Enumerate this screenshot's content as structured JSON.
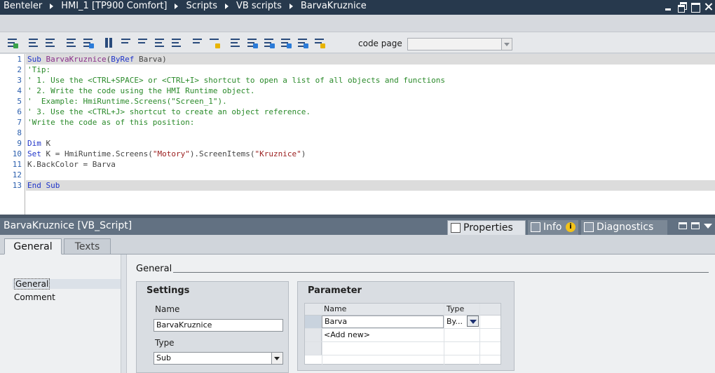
{
  "titlebar": {
    "breadcrumbs": [
      "Benteler",
      "HMI_1 [TP900 Comfort]",
      "Scripts",
      "VB scripts",
      "BarvaKruznice"
    ]
  },
  "toolbar": {
    "icons": [
      "compile-icon",
      "indent-icon",
      "outdent-icon",
      "comment-icon",
      "uncomment-icon",
      "bookmark-icon",
      "prev-bookmark-icon",
      "next-bookmark-icon",
      "delete-bookmarks-icon",
      "goto-icon",
      "find-icon",
      "highlight-icon",
      "select-object-icon",
      "object-list-icon",
      "member-list-icon",
      "parameter-info-icon",
      "word-complete-icon",
      "snippet-icon"
    ],
    "code_page_label": "code page",
    "code_page_value": ""
  },
  "editor": {
    "line_numbers": [
      "1",
      "2",
      "3",
      "4",
      "5",
      "6",
      "7",
      "8",
      "9",
      "10",
      "11",
      "12",
      "13"
    ],
    "lines": [
      {
        "n": 1,
        "parts": [
          [
            "kw",
            "Sub "
          ],
          [
            "fn",
            "BarvaKruznice"
          ],
          [
            "ob",
            "("
          ],
          [
            "kw",
            "ByRef"
          ],
          [
            "ob",
            " Barva)"
          ]
        ]
      },
      {
        "n": 2,
        "parts": [
          [
            "cm",
            "'Tip:"
          ]
        ]
      },
      {
        "n": 3,
        "parts": [
          [
            "cm",
            "' 1. Use the <CTRL+SPACE> or <CTRL+I> shortcut to open a list of all objects and functions"
          ]
        ]
      },
      {
        "n": 4,
        "parts": [
          [
            "cm",
            "' 2. Write the code using the HMI Runtime object."
          ]
        ]
      },
      {
        "n": 5,
        "parts": [
          [
            "cm",
            "'  Example: HmiRuntime.Screens(\"Screen_1\")."
          ]
        ]
      },
      {
        "n": 6,
        "parts": [
          [
            "cm",
            "' 3. Use the <CTRL+J> shortcut to create an object reference."
          ]
        ]
      },
      {
        "n": 7,
        "parts": [
          [
            "cm",
            "'Write the code as of this position:"
          ]
        ]
      },
      {
        "n": 8,
        "parts": []
      },
      {
        "n": 9,
        "parts": [
          [
            "kw",
            "Dim"
          ],
          [
            "ob",
            " K"
          ]
        ]
      },
      {
        "n": 10,
        "parts": [
          [
            "kw",
            "Set"
          ],
          [
            "ob",
            " K = HmiRuntime.Screens("
          ],
          [
            "st",
            "\"Motory\""
          ],
          [
            "ob",
            ").ScreenItems("
          ],
          [
            "st",
            "\"Kruznice\""
          ],
          [
            "ob",
            ")"
          ]
        ]
      },
      {
        "n": 11,
        "parts": [
          [
            "ob",
            "K.BackColor = Barva"
          ]
        ]
      },
      {
        "n": 12,
        "parts": []
      },
      {
        "n": 13,
        "parts": [
          [
            "kw",
            "End Sub"
          ]
        ]
      }
    ],
    "highlighted_lines": [
      1,
      13
    ]
  },
  "inspector": {
    "title": "BarvaKruznice [VB_Script]",
    "tabs": {
      "properties": "Properties",
      "info": "Info",
      "info_badge": "i",
      "diagnostics": "Diagnostics"
    },
    "subtabs": {
      "general": "General",
      "texts": "Texts"
    },
    "nav": {
      "general": "General",
      "comment": "Comment"
    },
    "section_title": "General",
    "settings": {
      "title": "Settings",
      "name_label": "Name",
      "name_value": "BarvaKruznice",
      "type_label": "Type",
      "type_value": "Sub"
    },
    "parameter": {
      "title": "Parameter",
      "col_name": "Name",
      "col_type": "Type",
      "rows": [
        {
          "name": "Barva",
          "type": "By..."
        },
        {
          "name": "<Add new>",
          "type": ""
        }
      ]
    }
  },
  "colors": {
    "titlebar_bg": "#27394d",
    "inspector_header_bg": "#627182",
    "keyword": "#1f34c9",
    "comment": "#2a8a2a",
    "string": "#9a1d1d",
    "function": "#8a2f8a",
    "line_number": "#2b5fae"
  }
}
